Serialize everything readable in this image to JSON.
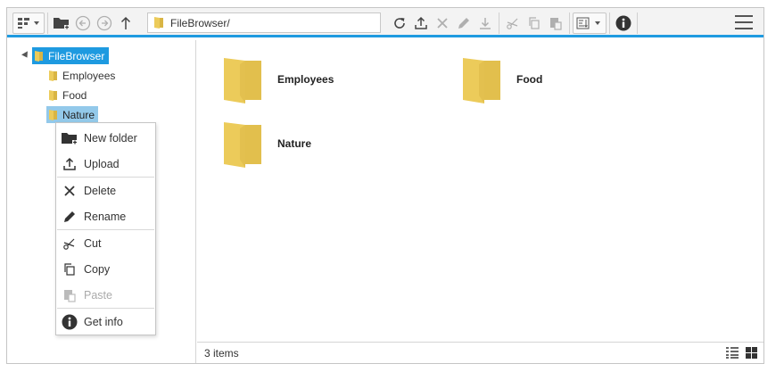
{
  "address": {
    "path": "FileBrowser/"
  },
  "tree": {
    "root": "FileBrowser",
    "children": [
      "Employees",
      "Food",
      "Nature"
    ]
  },
  "content": {
    "items": [
      "Employees",
      "Food",
      "Nature"
    ]
  },
  "status": {
    "count": "3 items"
  },
  "context_menu": {
    "items": [
      {
        "label": "New folder",
        "icon": "new-folder-icon",
        "enabled": true
      },
      {
        "label": "Upload",
        "icon": "upload-icon",
        "enabled": true
      },
      {
        "label": "Delete",
        "icon": "close-icon",
        "enabled": true
      },
      {
        "label": "Rename",
        "icon": "pencil-icon",
        "enabled": true
      },
      {
        "label": "Cut",
        "icon": "scissors-icon",
        "enabled": true
      },
      {
        "label": "Copy",
        "icon": "copy-icon",
        "enabled": true
      },
      {
        "label": "Paste",
        "icon": "paste-icon",
        "enabled": false
      },
      {
        "label": "Get info",
        "icon": "info-icon",
        "enabled": true
      }
    ]
  },
  "colors": {
    "accent": "#1e9ae0",
    "folder": "#eccb5a",
    "tree_selected": "#93c9ea"
  }
}
